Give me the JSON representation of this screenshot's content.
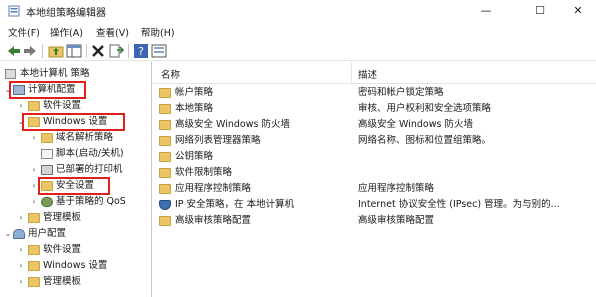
{
  "window": {
    "title": "本地组策略编辑器",
    "min_glyph": "—",
    "max_glyph": "☐",
    "close_glyph": "✕"
  },
  "menu": [
    "文件(F)",
    "操作(A)",
    "查看(V)",
    "帮助(H)"
  ],
  "toolbar": {
    "icons": [
      "back-arrow-icon",
      "forward-arrow-icon",
      "folder-up-icon",
      "show-hide-tree-icon",
      "delete-icon",
      "export-list-icon",
      "help-icon",
      "properties-icon"
    ]
  },
  "tree": {
    "root": "本地计算机 策略",
    "computer_config": "计算机配置",
    "software_settings": "软件设置",
    "windows_settings": "Windows 设置",
    "name_resolution_policy": "域名解析策略",
    "scripts": "脚本(启动/关机)",
    "deployed_printers": "已部署的打印机",
    "security_settings": "安全设置",
    "qos": "基于策略的 QoS",
    "admin_templates": "管理模板",
    "user_config": "用户配置",
    "user_software_settings": "软件设置",
    "user_windows_settings": "Windows 设置",
    "user_admin_templates": "管理模板"
  },
  "list": {
    "col_name": "名称",
    "col_desc": "描述",
    "rows": [
      {
        "name": "帐户策略",
        "desc": "密码和帐户锁定策略",
        "icon": "folder-icon"
      },
      {
        "name": "本地策略",
        "desc": "审核、用户权利和安全选项策略",
        "icon": "folder-icon"
      },
      {
        "name": "高级安全 Windows 防火墙",
        "desc": "高级安全 Windows 防火墙",
        "icon": "folder-icon"
      },
      {
        "name": "网络列表管理器策略",
        "desc": "网络名称、图标和位置组策略。",
        "icon": "folder-icon"
      },
      {
        "name": "公钥策略",
        "desc": "",
        "icon": "folder-icon"
      },
      {
        "name": "软件限制策略",
        "desc": "",
        "icon": "folder-icon"
      },
      {
        "name": "应用程序控制策略",
        "desc": "应用程序控制策略",
        "icon": "folder-icon"
      },
      {
        "name": "IP 安全策略，在 本地计算机",
        "desc": "Internet 协议安全性 (IPsec) 管理。为与别的...",
        "icon": "ip-security-icon"
      },
      {
        "name": "高级审核策略配置",
        "desc": "高级审核策略配置",
        "icon": "folder-icon"
      }
    ]
  },
  "colors": {
    "highlight_border": "#e0201b",
    "folder": "#e9c566"
  }
}
